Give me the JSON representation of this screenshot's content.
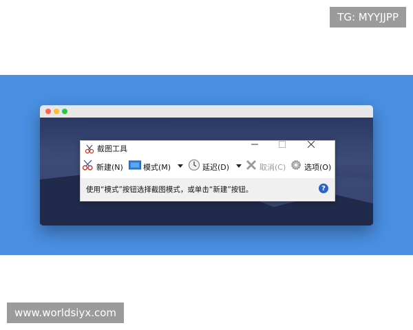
{
  "watermark_top": "TG: MYYJJPP",
  "watermark_bottom": "www.worldsiyx.com",
  "snipping_tool": {
    "title": "截图工具",
    "window_controls": {
      "minimize": "—",
      "maximize": "☐",
      "close": "✕"
    },
    "toolbar": {
      "new_label": "新建(N)",
      "mode_label": "模式(M)",
      "delay_label": "延迟(D)",
      "cancel_label": "取消(C)",
      "options_label": "选项(O)"
    },
    "status_message": "使用“模式”按钮选择截图模式，或单击“新建”按钮。",
    "help_label": "?"
  },
  "icons": [
    "scissors-icon",
    "mode-icon",
    "clock-icon",
    "cancel-x-icon",
    "gear-icon",
    "help-icon"
  ],
  "colors": {
    "background_blue": "#4a8fe2",
    "watermark_gray": "#9b9b9b",
    "help_blue": "#2e62c9"
  }
}
